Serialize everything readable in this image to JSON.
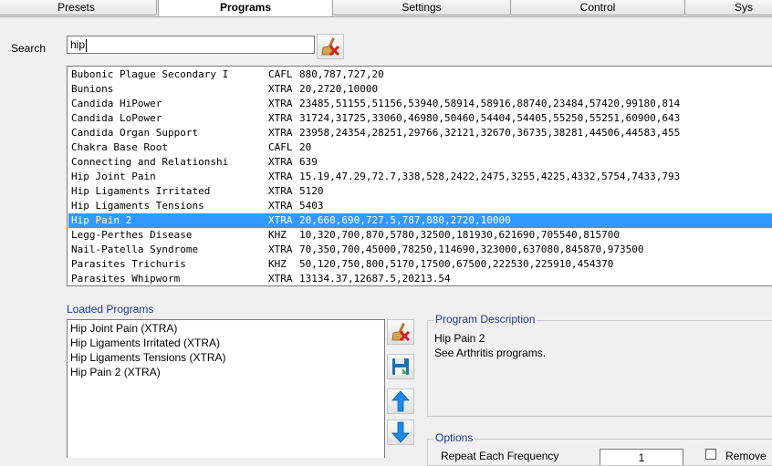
{
  "tabs": [
    {
      "label": "Presets",
      "active": false
    },
    {
      "label": "Programs",
      "active": true
    },
    {
      "label": "Settings",
      "active": false
    },
    {
      "label": "Control",
      "active": false
    },
    {
      "label": "Sys",
      "active": false
    }
  ],
  "search": {
    "label": "Search",
    "value": "hip"
  },
  "programs": [
    {
      "name": "Bubonic Plague Secondary I",
      "type": "CAFL",
      "freqs": "880,787,727,20"
    },
    {
      "name": "Bunions",
      "type": "XTRA",
      "freqs": "20,2720,10000"
    },
    {
      "name": "Candida HiPower",
      "type": "XTRA",
      "freqs": "23485,51155,51156,53940,58914,58916,88740,23484,57420,99180,814"
    },
    {
      "name": "Candida LoPower",
      "type": "XTRA",
      "freqs": "31724,31725,33060,46980,50460,54404,54405,55250,55251,60900,643"
    },
    {
      "name": "Candida Organ Support",
      "type": "XTRA",
      "freqs": "23958,24354,28251,29766,32121,32670,36735,38281,44506,44583,455"
    },
    {
      "name": "Chakra Base Root",
      "type": "CAFL",
      "freqs": "20"
    },
    {
      "name": "Connecting and Relationshi",
      "type": "XTRA",
      "freqs": "639"
    },
    {
      "name": "Hip Joint Pain",
      "type": "XTRA",
      "freqs": "15.19,47.29,72.7,338,528,2422,2475,3255,4225,4332,5754,7433,793"
    },
    {
      "name": "Hip Ligaments Irritated",
      "type": "XTRA",
      "freqs": "5120"
    },
    {
      "name": "Hip Ligaments Tensions",
      "type": "XTRA",
      "freqs": "5403"
    },
    {
      "name": "Hip Pain 2",
      "type": "XTRA",
      "freqs": "20,660,690,727.5,787,880,2720,10000",
      "selected": true
    },
    {
      "name": "Legg-Perthes Disease",
      "type": "KHZ",
      "freqs": "10,320,700,870,5780,32500,181930,621690,705540,815700"
    },
    {
      "name": "Nail-Patella Syndrome",
      "type": "XTRA",
      "freqs": "70,350,700,45000,78250,114690,323000,637080,845870,973500"
    },
    {
      "name": "Parasites Trichuris",
      "type": "KHZ",
      "freqs": "50,120,750,800,5170,17500,67500,222530,225910,454370"
    },
    {
      "name": "Parasites Whipworm",
      "type": "XTRA",
      "freqs": "13134.37,12687.5,20213.54"
    }
  ],
  "loaded": {
    "label": "Loaded Programs",
    "items": [
      "Hip Joint Pain (XTRA)",
      "Hip Ligaments Irritated (XTRA)",
      "Hip Ligaments Tensions (XTRA)",
      "Hip Pain 2 (XTRA)"
    ]
  },
  "description": {
    "title": "Program Description",
    "line1": "Hip Pain 2",
    "line2": "See Arthritis programs."
  },
  "options": {
    "title": "Options",
    "repeat_label": "Repeat Each Frequency",
    "repeat_value": "1",
    "remove_label": "Remove"
  },
  "icons": {
    "clear": "broom-clear-icon",
    "save": "floppy-save-icon",
    "up": "arrow-up-icon",
    "down": "arrow-down-icon"
  },
  "colors": {
    "selection": "#3399ff",
    "group_title": "#1e3a8c",
    "arrow": "#1e88e5"
  }
}
